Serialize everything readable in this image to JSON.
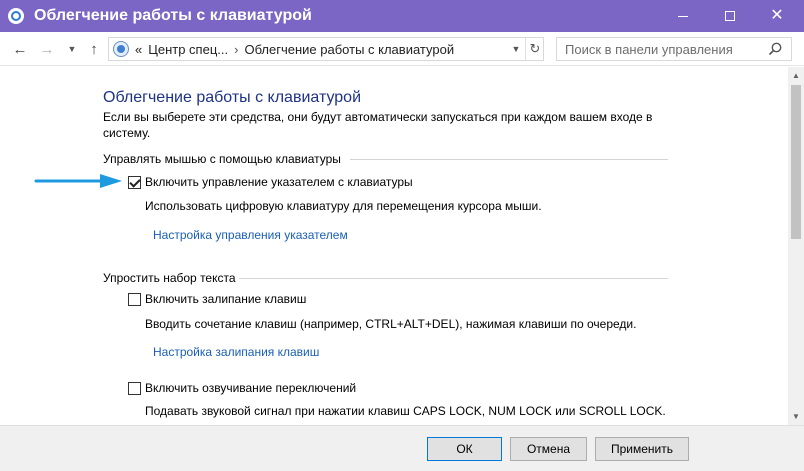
{
  "window": {
    "title": "Облегчение работы с клавиатурой"
  },
  "address_bar": {
    "separator": "«",
    "crumb1": "Центр спец...",
    "crumb_sep": "›",
    "crumb2": "Облегчение работы с клавиатурой"
  },
  "search": {
    "placeholder": "Поиск в панели управления"
  },
  "content": {
    "title": "Облегчение работы с клавиатурой",
    "intro": "Если вы выберете эти средства, они будут автоматически запускаться при каждом вашем входе в систему.",
    "sections": [
      {
        "heading": "Управлять мышью с помощью клавиатуры",
        "options": [
          {
            "label": "Включить управление указателем с клавиатуры",
            "checked": true,
            "description": "Использовать цифровую клавиатуру для перемещения курсора мыши.",
            "link": "Настройка управления указателем"
          }
        ]
      },
      {
        "heading": "Упростить набор текста",
        "options": [
          {
            "label": "Включить залипание клавиш",
            "checked": false,
            "description": "Вводить сочетание клавиш (например, CTRL+ALT+DEL), нажимая клавиши по очереди.",
            "link": "Настройка залипания клавиш"
          },
          {
            "label": "Включить озвучивание переключений",
            "checked": false,
            "description": "Подавать звуковой сигнал при нажатии клавиш CAPS LOCK, NUM LOCK или SCROLL LOCK."
          }
        ]
      }
    ]
  },
  "footer": {
    "ok": "ОК",
    "cancel": "Отмена",
    "apply": "Применить"
  },
  "colors": {
    "titlebar": "#7c66c5",
    "title_text": "#1e3287",
    "link": "#1a5fb4",
    "arrow": "#1e9be0"
  }
}
